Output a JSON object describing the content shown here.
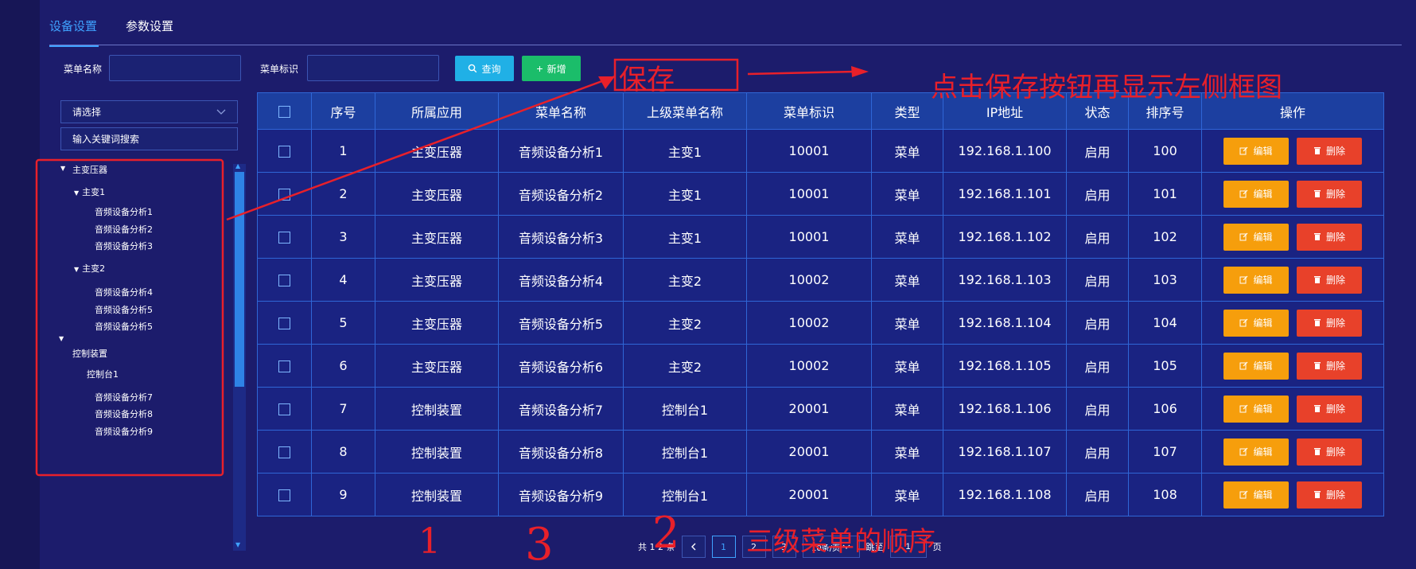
{
  "tabs": [
    {
      "label": "设备设置",
      "active": true
    },
    {
      "label": "参数设置",
      "active": false
    }
  ],
  "filters": {
    "menu_name_label": "菜单名称",
    "menu_name_value": "",
    "menu_id_label": "菜单标识",
    "menu_id_value": "",
    "query_label": "查询",
    "add_label": "新增"
  },
  "sidebar": {
    "select_placeholder": "请选择",
    "search_placeholder": "输入关键词搜索",
    "tree": {
      "n1": "主变压器",
      "n1_1": "主变1",
      "n1_1_1": "音频设备分析1",
      "n1_1_2": "音频设备分析2",
      "n1_1_3": "音频设备分析3",
      "n1_2": "主变2",
      "n1_2_1": "音频设备分析4",
      "n1_2_2": "音频设备分析5",
      "n1_2_3": "音频设备分析5",
      "n2": "控制装置",
      "n2_1": "控制台1",
      "n2_1_1": "音频设备分析7",
      "n2_1_2": "音频设备分析8",
      "n2_1_3": "音频设备分析9"
    }
  },
  "table": {
    "headers": [
      "序号",
      "所属应用",
      "菜单名称",
      "上级菜单名称",
      "菜单标识",
      "类型",
      "IP地址",
      "状态",
      "排序号",
      "操作"
    ],
    "edit_label": "编辑",
    "delete_label": "删除",
    "rows": [
      [
        "1",
        "主变压器",
        "音频设备分析1",
        "主变1",
        "10001",
        "菜单",
        "192.168.1.100",
        "启用",
        "100"
      ],
      [
        "2",
        "主变压器",
        "音频设备分析2",
        "主变1",
        "10001",
        "菜单",
        "192.168.1.101",
        "启用",
        "101"
      ],
      [
        "3",
        "主变压器",
        "音频设备分析3",
        "主变1",
        "10001",
        "菜单",
        "192.168.1.102",
        "启用",
        "102"
      ],
      [
        "4",
        "主变压器",
        "音频设备分析4",
        "主变2",
        "10002",
        "菜单",
        "192.168.1.103",
        "启用",
        "103"
      ],
      [
        "5",
        "主变压器",
        "音频设备分析5",
        "主变2",
        "10002",
        "菜单",
        "192.168.1.104",
        "启用",
        "104"
      ],
      [
        "6",
        "主变压器",
        "音频设备分析6",
        "主变2",
        "10002",
        "菜单",
        "192.168.1.105",
        "启用",
        "105"
      ],
      [
        "7",
        "控制装置",
        "音频设备分析7",
        "控制台1",
        "20001",
        "菜单",
        "192.168.1.106",
        "启用",
        "106"
      ],
      [
        "8",
        "控制装置",
        "音频设备分析8",
        "控制台1",
        "20001",
        "菜单",
        "192.168.1.107",
        "启用",
        "107"
      ],
      [
        "9",
        "控制装置",
        "音频设备分析9",
        "控制台1",
        "20001",
        "菜单",
        "192.168.1.108",
        "启用",
        "108"
      ]
    ]
  },
  "pager": {
    "total": "共 1 2 条",
    "current": "1",
    "page2": "2",
    "page3": "3",
    "size": "10条/页",
    "jump_prefix": "跳至",
    "jump_value": "1",
    "jump_suffix": "页"
  },
  "annotations": {
    "save_box": "保存",
    "instruction": "点击保存按钮再显示左侧框图",
    "order_note": "三级菜单的顺序",
    "hand_1": "1",
    "hand_2": "2",
    "hand_3": "3"
  },
  "colors": {
    "background": "#1c1c6c",
    "accent": "#3fa2ff",
    "edit": "#f69e0c",
    "delete": "#e8412a",
    "annotation": "#e8202a"
  }
}
